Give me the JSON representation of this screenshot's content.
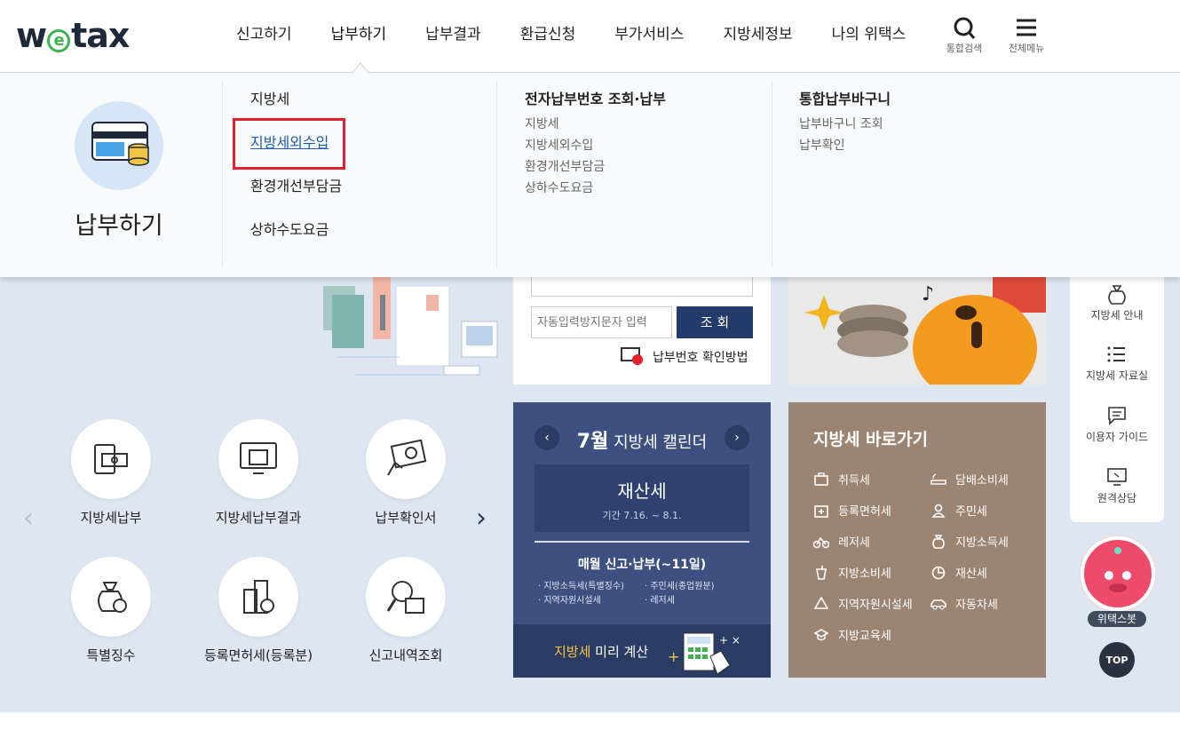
{
  "logo": {
    "text": "wetax"
  },
  "gnb": [
    "신고하기",
    "납부하기",
    "납부결과",
    "환급신청",
    "부가서비스",
    "지방세정보",
    "나의 위택스"
  ],
  "header_icons": {
    "search": "통합검색",
    "menu": "전체메뉴"
  },
  "mega": {
    "title": "납부하기",
    "col1": [
      "지방세",
      "지방세외수입",
      "환경개선부담금",
      "상하수도요금"
    ],
    "col2": {
      "head": "전자납부번호 조회·납부",
      "items": [
        "지방세",
        "지방세외수입",
        "환경개선부담금",
        "상하수도요금"
      ]
    },
    "col3": {
      "head": "통합납부바구니",
      "items": [
        "납부바구니 조회",
        "납부확인"
      ]
    }
  },
  "search": {
    "captcha_placeholder": "자동입력방지문자 입력",
    "query_button": "조 회",
    "paynum_guide": "납부번호 확인방법"
  },
  "quick_icons": [
    "지방세납부",
    "지방세납부결과",
    "납부확인서",
    "특별징수",
    "등록면허세(등록분)",
    "신고내역조회"
  ],
  "calendar": {
    "month": "7월",
    "title_suffix": "지방세 캘린더",
    "tax": "재산세",
    "period": "기간 7.16. ~ 8.1.",
    "monthly": "매월 신고·납부(~11일)",
    "list_left": [
      "· 지방소득세(특별징수)",
      "· 지역자원시설세"
    ],
    "list_right": [
      "· 주민세(종업원분)",
      "· 레저세"
    ],
    "calc_highlight": "지방세",
    "calc_rest": " 미리 계산"
  },
  "shortcuts": {
    "title": "지방세 바로가기",
    "left": [
      "취득세",
      "등록면허세",
      "레저세",
      "지방소비세",
      "지역자원시설세",
      "지방교육세"
    ],
    "right": [
      "담배소비세",
      "주민세",
      "지방소득세",
      "재산세",
      "자동차세"
    ]
  },
  "right_bar": [
    "지방세 안내",
    "지방세 자료실",
    "이용자 가이드",
    "원격상담"
  ],
  "bot_label": "위택스봇",
  "top_label": "TOP",
  "colors": {
    "navy": "#233b6b",
    "calendar": "#3d5080",
    "shortcuts": "#9c8472",
    "highlight": "#e3202b",
    "link": "#1f5bb0"
  }
}
